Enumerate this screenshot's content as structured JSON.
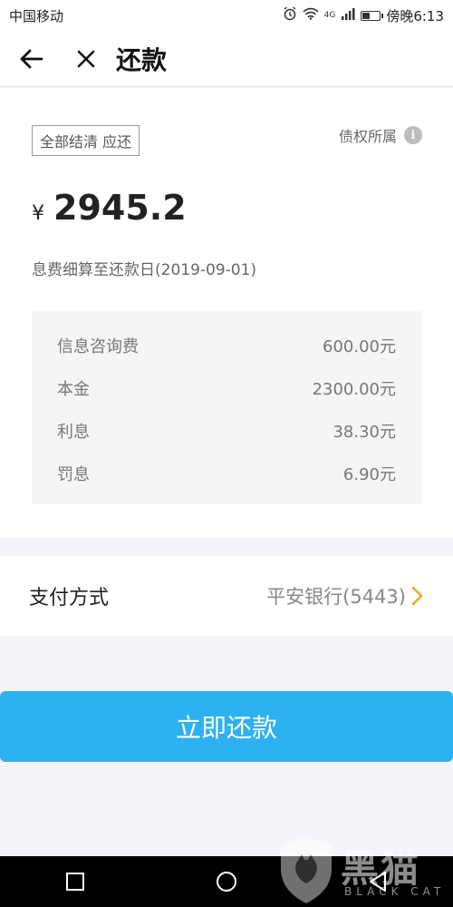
{
  "status_bar": {
    "carrier": "中国移动",
    "network": "4G",
    "time": "傍晚6:13",
    "battery_level": 0.5
  },
  "header": {
    "title": "还款",
    "back_icon": "arrow-left-icon",
    "close_icon": "close-icon"
  },
  "repayment": {
    "tag_label": "全部结清 应还",
    "creditor_label": "债权所属",
    "currency_symbol": "¥",
    "amount": "2945.2",
    "interest_note": "息费细算至还款日(2019-09-01)",
    "details": [
      {
        "label": "信息咨询费",
        "value": "600.00元"
      },
      {
        "label": "本金",
        "value": "2300.00元"
      },
      {
        "label": "利息",
        "value": "38.30元"
      },
      {
        "label": "罚息",
        "value": "6.90元"
      }
    ]
  },
  "payment": {
    "label": "支付方式",
    "bank": "平安银行(5443)",
    "arrow": ">"
  },
  "action": {
    "pay_now_label": "立即还款"
  },
  "watermark": {
    "text": "黑猫",
    "subtext": "BLACK CAT"
  },
  "colors": {
    "primary": "#2eb1f0",
    "arrow": "#f5a623",
    "background": "#f5f5f9"
  }
}
